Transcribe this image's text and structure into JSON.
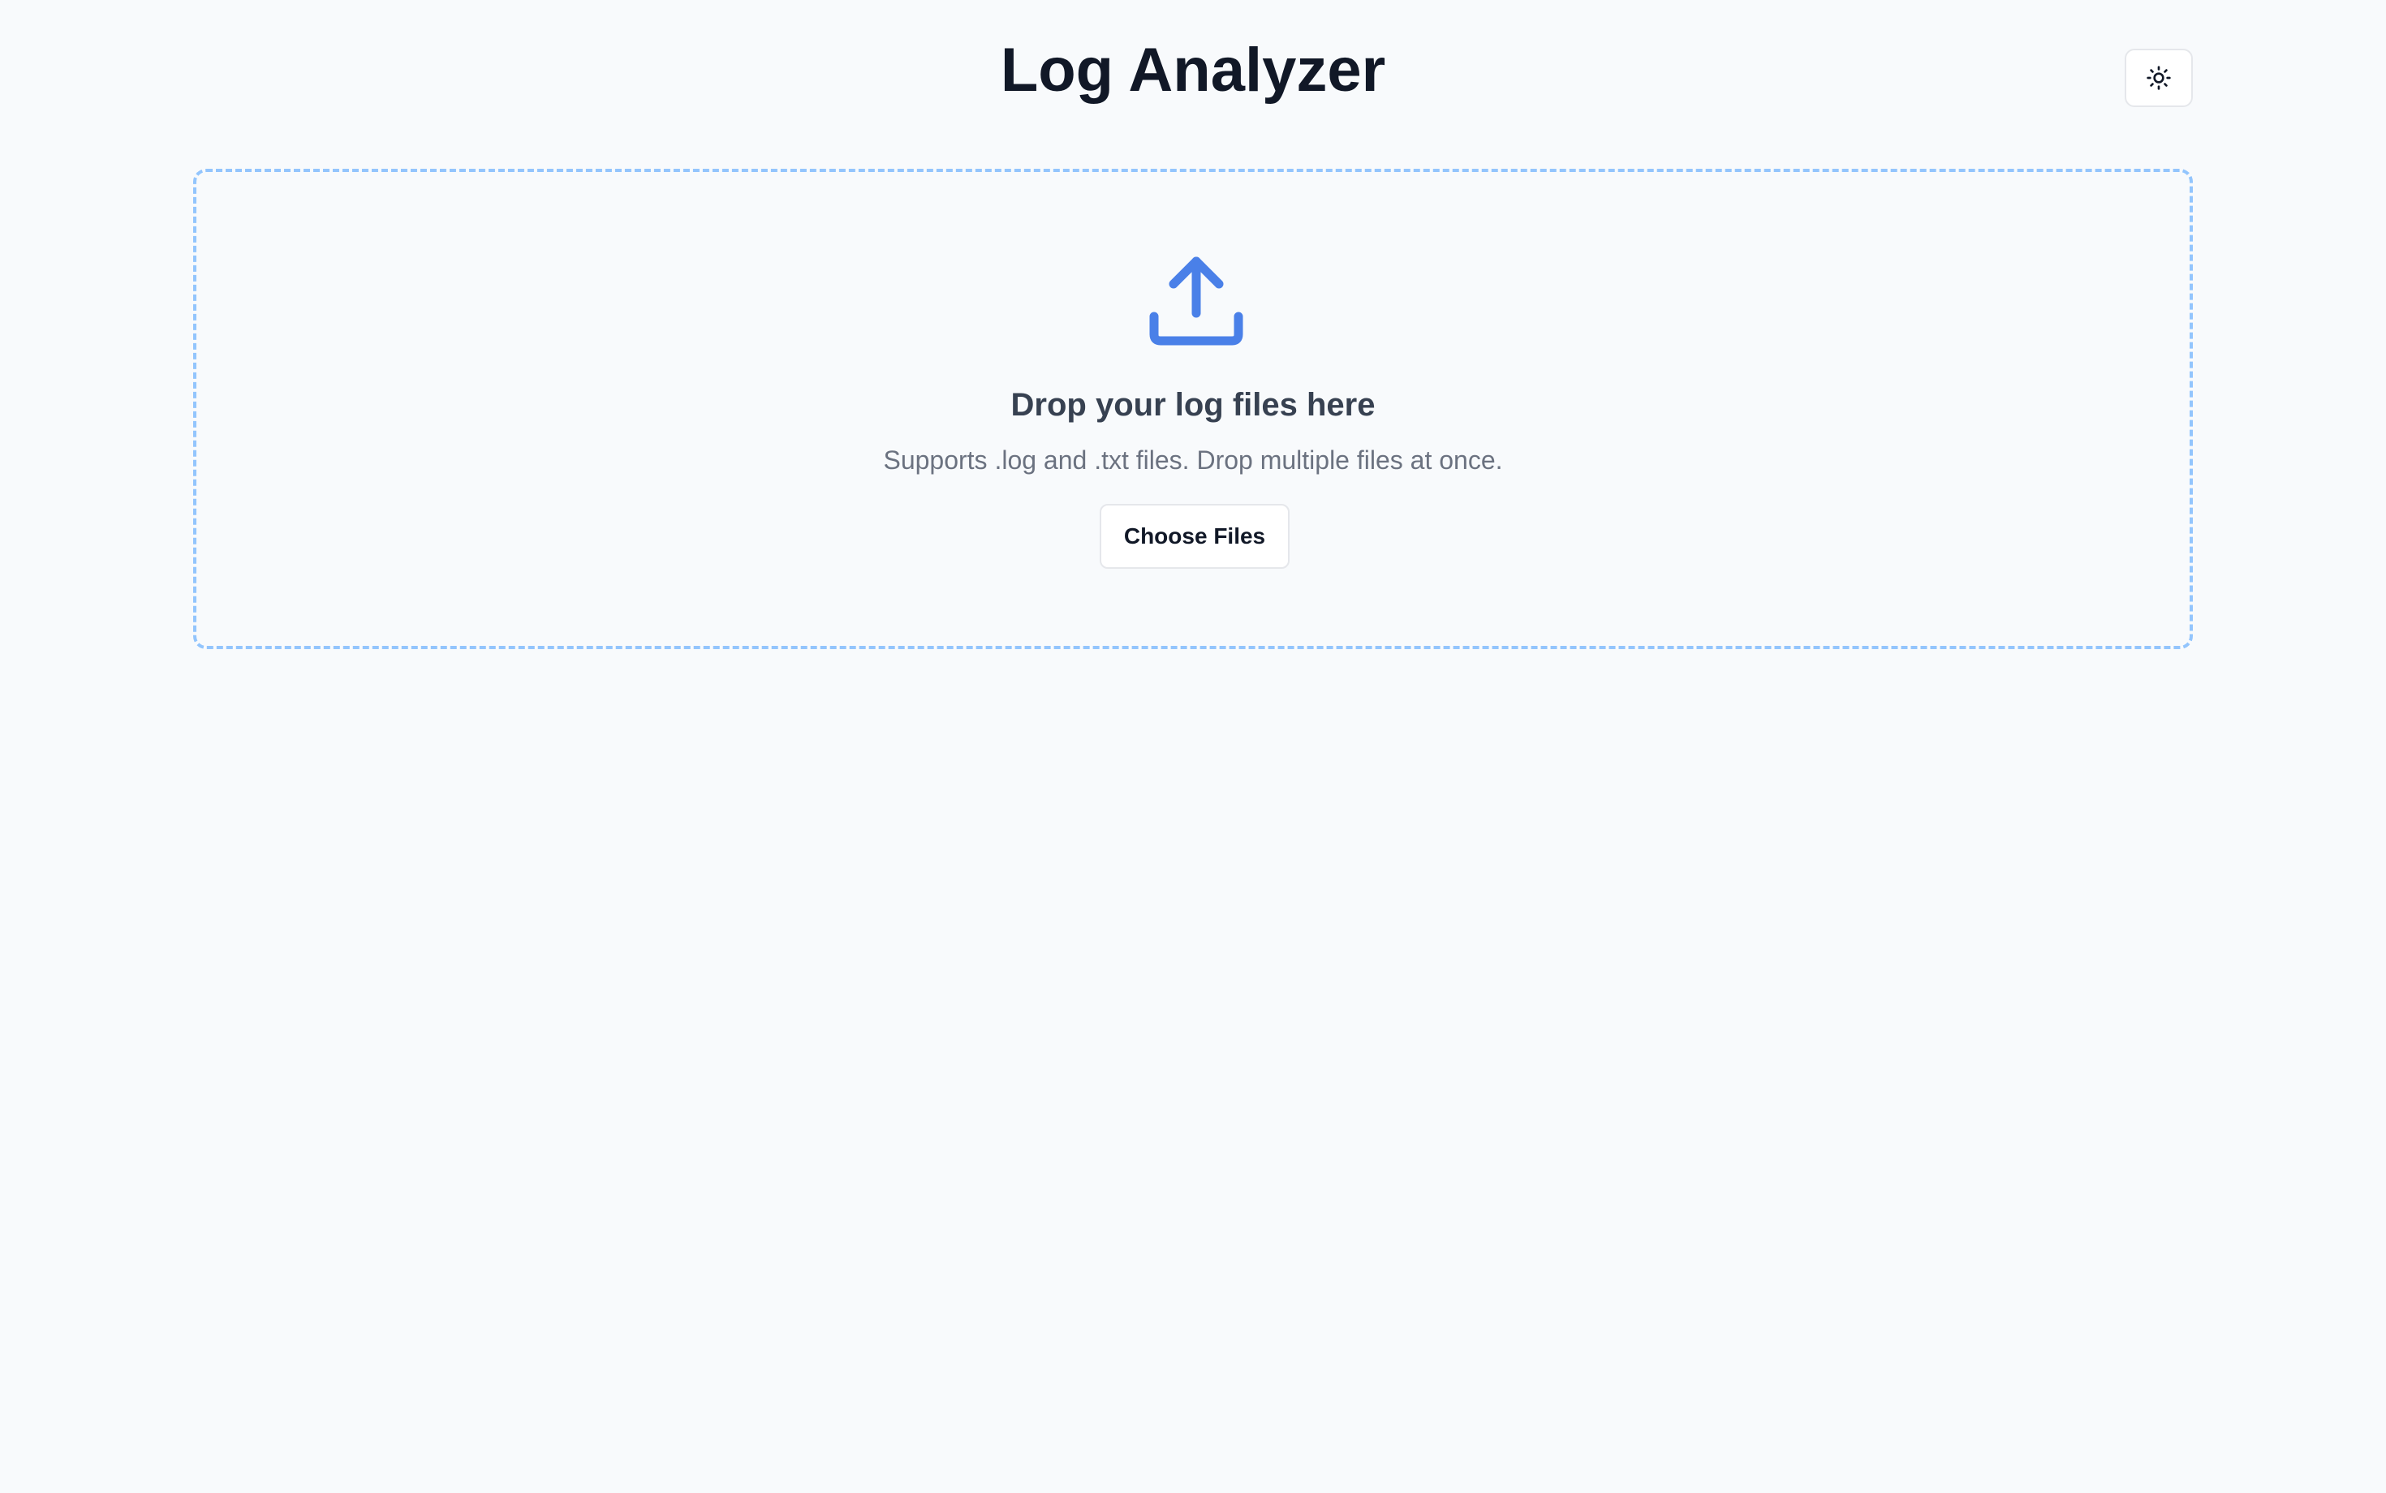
{
  "app": {
    "title": "Log Analyzer"
  },
  "header": {
    "theme_toggle_icon": "sun-icon"
  },
  "dropzone": {
    "icon": "upload-icon",
    "title": "Drop your log files here",
    "subtitle": "Supports .log and .txt files. Drop multiple files at once.",
    "button_label": "Choose Files"
  },
  "colors": {
    "background": "#f8fafc",
    "accent": "#4a80e8",
    "dropzone_border": "#93c5fd",
    "title_text": "#111827",
    "muted_text": "#6b7280"
  }
}
